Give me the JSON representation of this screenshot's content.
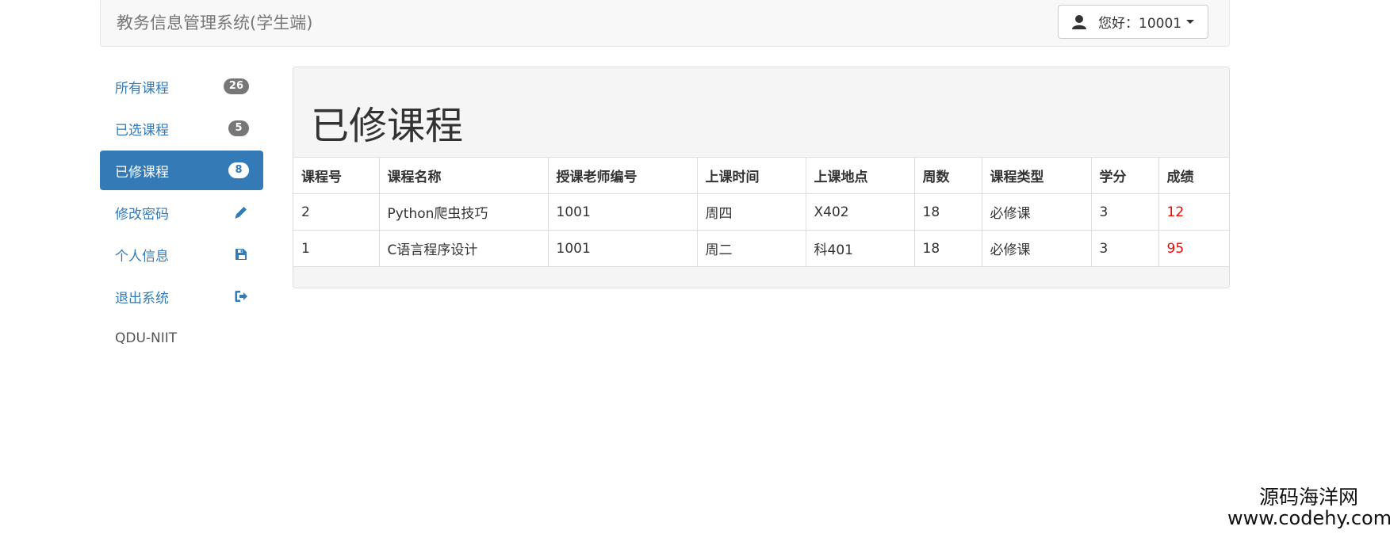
{
  "navbar": {
    "brand": "教务信息管理系统(学生端)",
    "user_label": "您好：10001"
  },
  "sidebar": {
    "items": [
      {
        "label": "所有课程",
        "badge": "26",
        "icon": null,
        "active": false
      },
      {
        "label": "已选课程",
        "badge": "5",
        "icon": null,
        "active": false
      },
      {
        "label": "已修课程",
        "badge": "8",
        "icon": null,
        "active": true
      },
      {
        "label": "修改密码",
        "badge": null,
        "icon": "pencil-icon",
        "active": false
      },
      {
        "label": "个人信息",
        "badge": null,
        "icon": "save-icon",
        "active": false
      },
      {
        "label": "退出系统",
        "badge": null,
        "icon": "logout-icon",
        "active": false
      }
    ],
    "footer": "QDU-NIIT"
  },
  "main": {
    "title": "已修课程",
    "table": {
      "headers": [
        "课程号",
        "课程名称",
        "授课老师编号",
        "上课时间",
        "上课地点",
        "周数",
        "课程类型",
        "学分",
        "成绩"
      ],
      "rows": [
        [
          "2",
          "Python爬虫技巧",
          "1001",
          "周四",
          "X402",
          "18",
          "必修课",
          "3",
          "12"
        ],
        [
          "1",
          "C语言程序设计",
          "1001",
          "周二",
          "科401",
          "18",
          "必修课",
          "3",
          "95"
        ]
      ]
    }
  },
  "watermark": {
    "name": "源码海洋网",
    "url": "www.codehy.com"
  },
  "colors": {
    "primary": "#337ab7",
    "score": "#ff0000",
    "badge": "#777777"
  }
}
